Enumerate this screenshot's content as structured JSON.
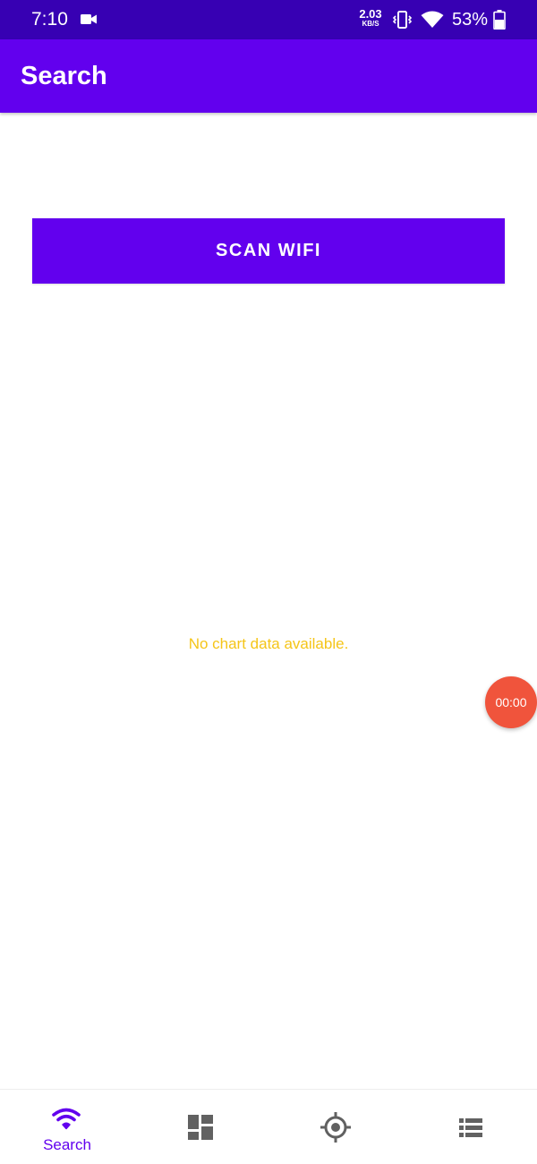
{
  "status_bar": {
    "time": "7:10",
    "net_speed_value": "2.03",
    "net_speed_unit": "KB/S",
    "battery": "53%"
  },
  "app_bar": {
    "title": "Search"
  },
  "scan_button_label": "SCAN WIFI",
  "empty_message": "No chart data available.",
  "timer": "00:00",
  "bottom_nav": [
    {
      "label": "Search",
      "icon": "wifi-icon",
      "active": true
    },
    {
      "label": "",
      "icon": "dashboard-icon",
      "active": false
    },
    {
      "label": "",
      "icon": "location-target-icon",
      "active": false
    },
    {
      "label": "",
      "icon": "list-icon",
      "active": false
    }
  ],
  "colors": {
    "primary": "#6200ee",
    "status_bar": "#3700b3",
    "empty_text": "#f5c518",
    "timer_fab": "#f0543c",
    "inactive_icon": "#616161"
  }
}
